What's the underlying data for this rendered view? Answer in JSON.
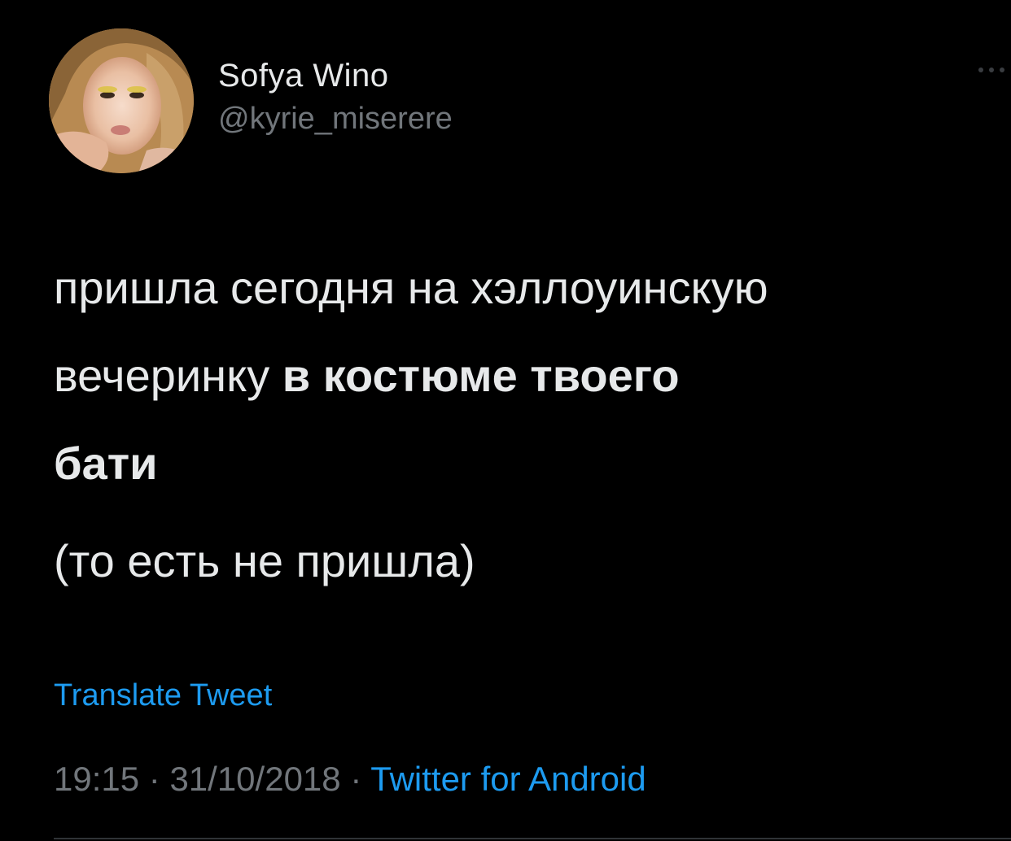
{
  "author": {
    "display_name": "Sofya Wino",
    "handle": "@kyrie_miserere"
  },
  "tweet": {
    "line1": "пришла сегодня на хэллоуинскую",
    "line2_plain": "вечеринку ",
    "line2_bold": "в костюме твоего",
    "line3_bold": "бати",
    "paren": "(то есть не пришла)"
  },
  "translate_label": "Translate Tweet",
  "meta": {
    "time": "19:15",
    "sep1": " · ",
    "date": "31/10/2018",
    "sep2": " · ",
    "source": "Twitter for Android"
  },
  "icons": {
    "more": "more-dots-icon",
    "avatar": "avatar-photo"
  },
  "colors": {
    "background": "#000000",
    "text": "#e7e9ea",
    "muted": "#71767b",
    "link": "#1d9bf0"
  }
}
